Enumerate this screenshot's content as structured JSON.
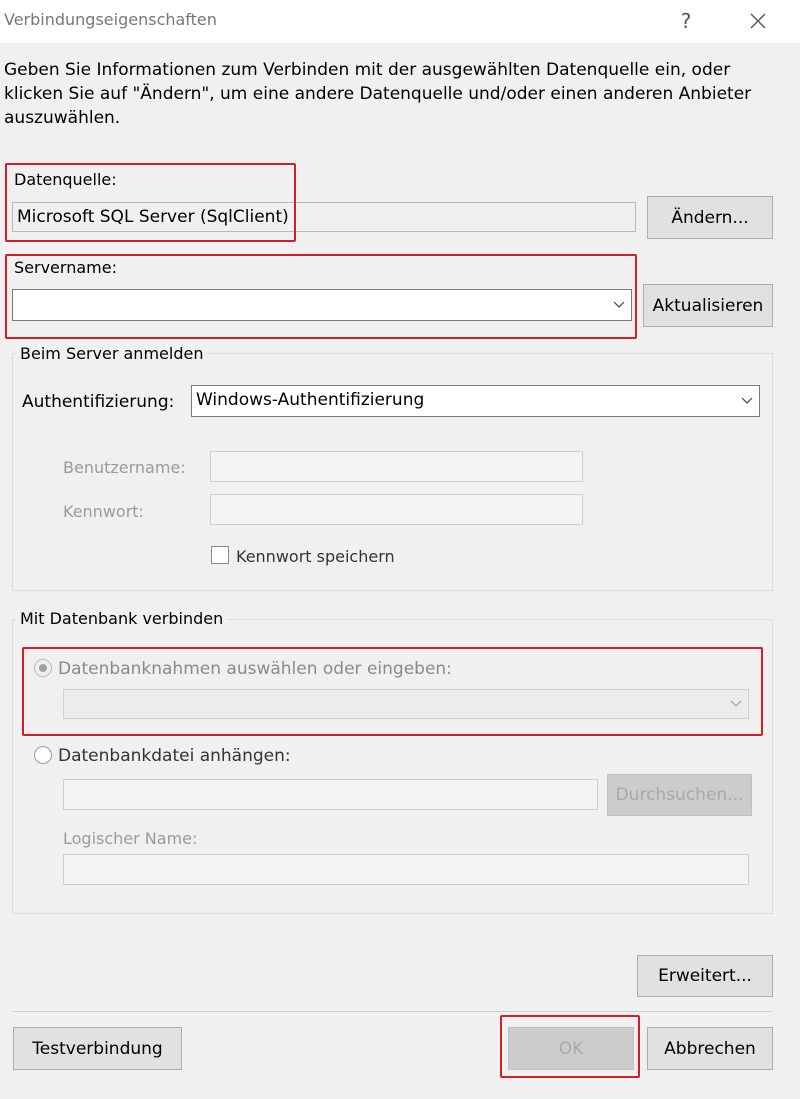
{
  "window": {
    "title": "Verbindungseigenschaften",
    "help_glyph": "?",
    "close_glyph": "✕"
  },
  "description": "Geben Sie Informationen zum Verbinden mit der ausgewählten Datenquelle ein, oder klicken Sie auf \"Ändern\", um eine andere Datenquelle und/oder einen anderen Anbieter auszuwählen.",
  "datasource": {
    "label": "Datenquelle:",
    "value": "Microsoft SQL Server (SqlClient)",
    "change_button": "Ändern..."
  },
  "server": {
    "label": "Servername:",
    "value": "",
    "refresh_button": "Aktualisieren"
  },
  "login": {
    "group_title": "Beim Server anmelden",
    "auth_label": "Authentifizierung:",
    "auth_value": "Windows-Authentifizierung",
    "username_label": "Benutzername:",
    "password_label": "Kennwort:",
    "save_password_label": "Kennwort speichern"
  },
  "database": {
    "group_title": "Mit Datenbank verbinden",
    "select_option": "Datenbanknahmen auswählen oder eingeben:",
    "attach_option": "Datenbankdatei anhängen:",
    "browse_button": "Durchsuchen...",
    "logical_name_label": "Logischer Name:"
  },
  "buttons": {
    "advanced": "Erweitert...",
    "test": "Testverbindung",
    "ok": "OK",
    "cancel": "Abbrechen"
  },
  "colors": {
    "highlight": "#d21f27",
    "dialog_bg": "#f0f0f0"
  }
}
